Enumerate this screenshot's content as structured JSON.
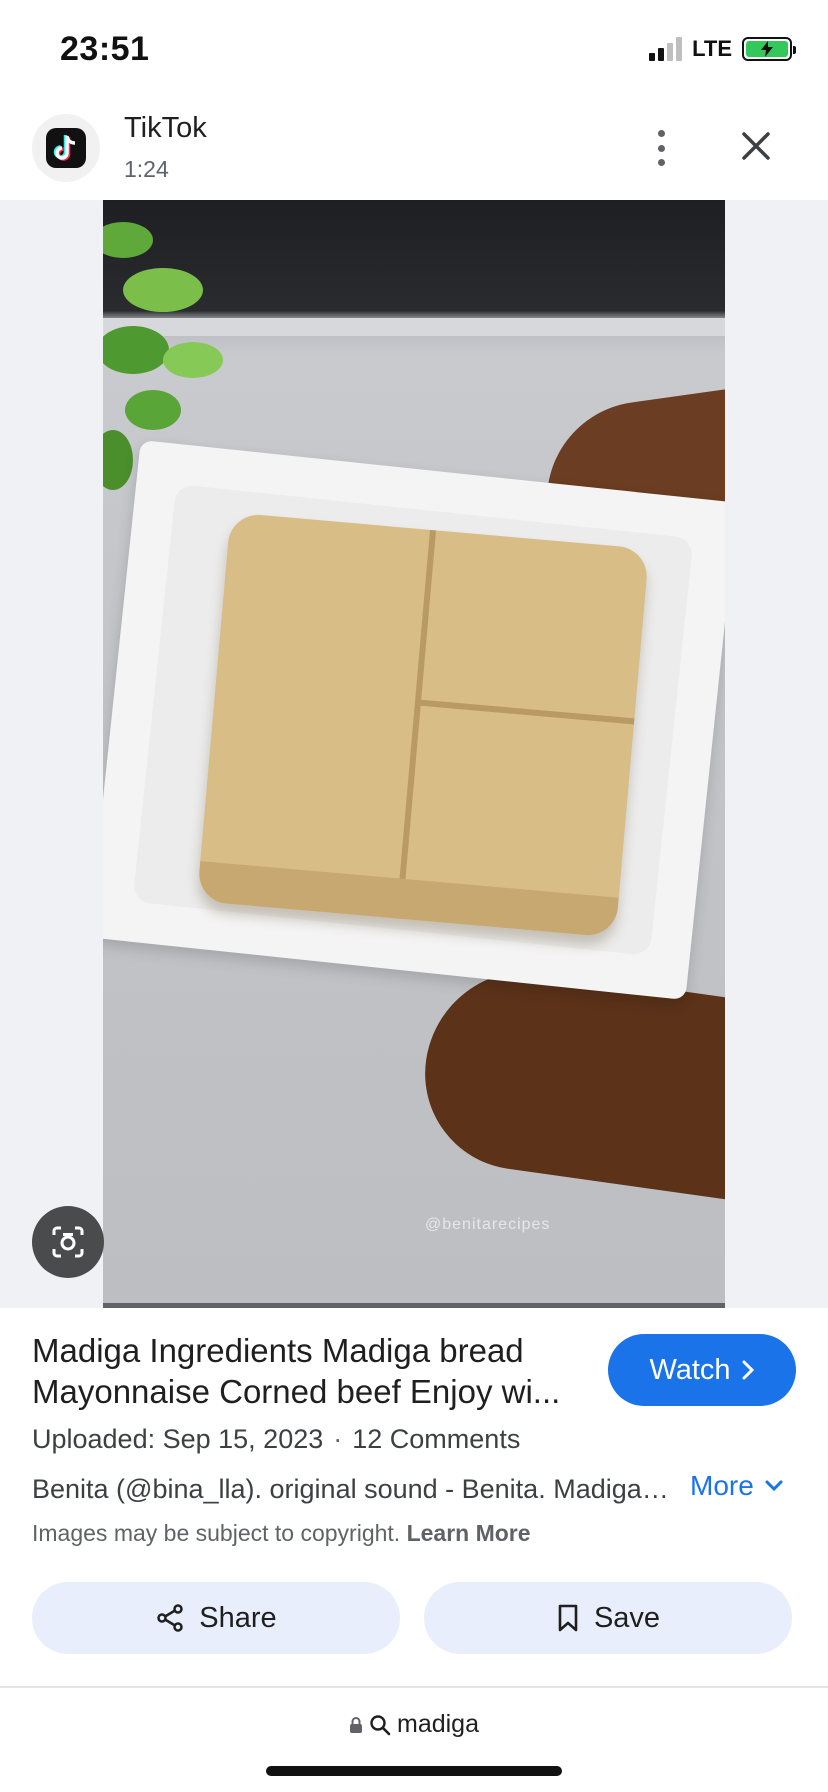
{
  "status_bar": {
    "time": "23:51",
    "network": "LTE"
  },
  "header": {
    "source_name": "TikTok",
    "duration": "1:24"
  },
  "media": {
    "watermark": "@benitarecipes"
  },
  "info": {
    "title": "Madiga Ingredients Madiga bread Mayonnaise Corned beef Enjoy wi...",
    "watch_label": "Watch",
    "uploaded": "Uploaded: Sep 15, 2023",
    "separator": "·",
    "comments": "12 Comments",
    "description": "Benita (@bina_lla). original sound - Benita. Madiga Ingredients",
    "more_label": "More",
    "copyright_text": "Images may be subject to copyright.",
    "learn_more": "Learn More"
  },
  "actions": {
    "share_label": "Share",
    "save_label": "Save"
  },
  "url_bar": {
    "query": "madiga"
  },
  "colors": {
    "accent": "#1a73e8",
    "button_bg": "#e8eefb",
    "battery": "#34c759"
  }
}
